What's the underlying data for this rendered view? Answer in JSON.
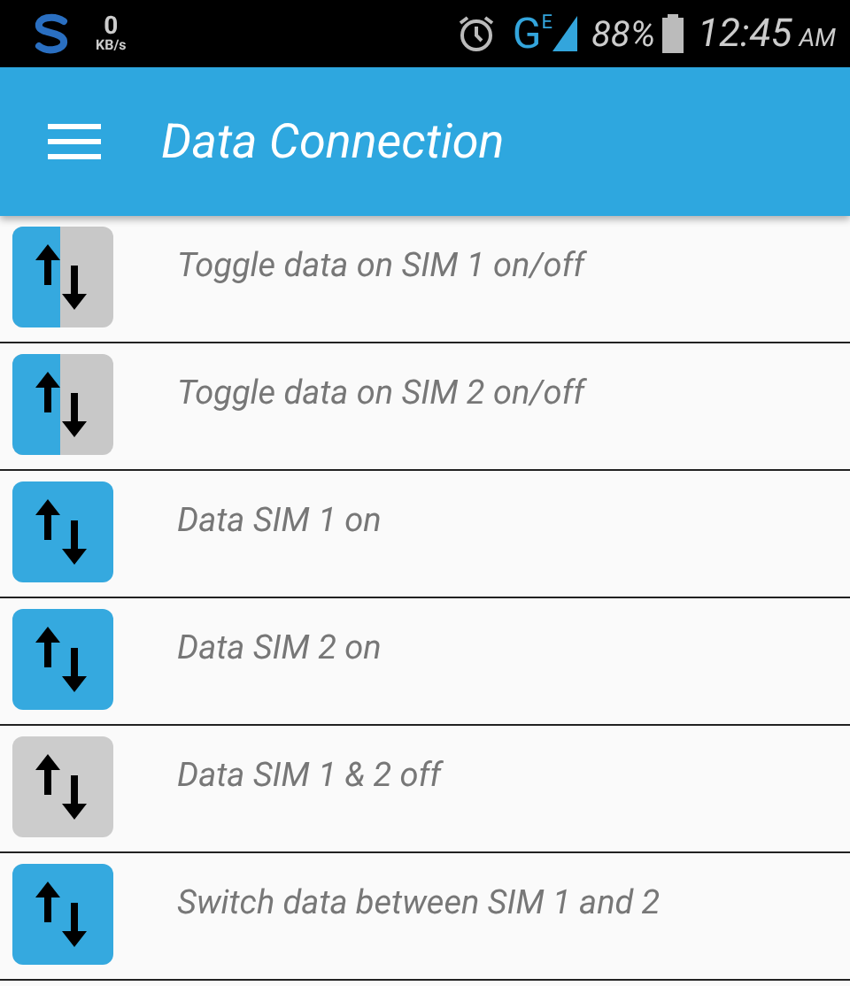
{
  "status_bar": {
    "speed_value": "0",
    "speed_unit": "KB/s",
    "network_type": "G",
    "network_subtype": "E",
    "battery": "88%",
    "time": "12:45",
    "meridiem": "AM"
  },
  "app_bar": {
    "title": "Data Connection"
  },
  "items": [
    {
      "label": "Toggle data on SIM 1 on/off",
      "kind": "split"
    },
    {
      "label": "Toggle data on SIM 2 on/off",
      "kind": "split"
    },
    {
      "label": "Data SIM 1 on",
      "kind": "on"
    },
    {
      "label": "Data SIM 2 on",
      "kind": "on"
    },
    {
      "label": "Data SIM 1 & 2 off",
      "kind": "off"
    },
    {
      "label": "Switch data between SIM 1 and 2",
      "kind": "on"
    }
  ]
}
